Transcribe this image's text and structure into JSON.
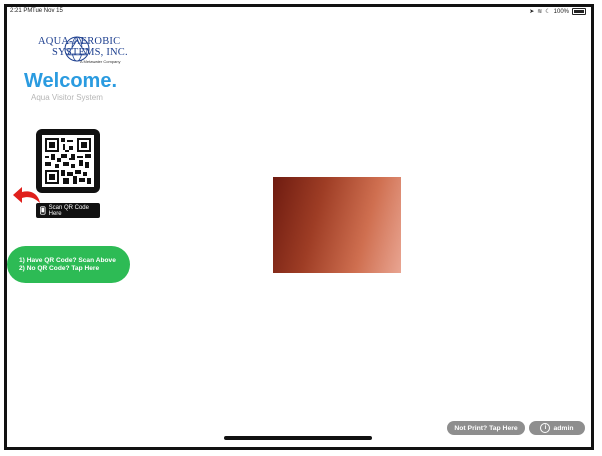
{
  "status_bar": {
    "time": "2:21 PM",
    "date": "Tue Nov 15",
    "battery": "100%"
  },
  "logo": {
    "line1": "AQUA-AEROBIC",
    "line2": "SYSTEMS, INC.",
    "line3": "A Metawater Company"
  },
  "welcome": {
    "title": "Welcome.",
    "subtitle": "Aqua Visitor System"
  },
  "qr": {
    "scan_label": "Scan QR Code Here"
  },
  "actions": {
    "line1": "1) Have QR Code? Scan Above",
    "line2": "2) No QR Code? Tap Here"
  },
  "footer": {
    "not_print_label": "Not Print? Tap Here",
    "admin_label": "admin"
  },
  "icons": [
    "logo-globe-icon",
    "qr-code-icon",
    "arrow-left-icon",
    "phone-icon",
    "info-icon",
    "wifi-icon",
    "moon-icon",
    "location-icon",
    "battery-icon"
  ],
  "colors": {
    "welcome": "#2a9be0",
    "action_button": "#2dbb55",
    "pill_buttons": "#8e8e8e",
    "arrow": "#e0201c"
  }
}
